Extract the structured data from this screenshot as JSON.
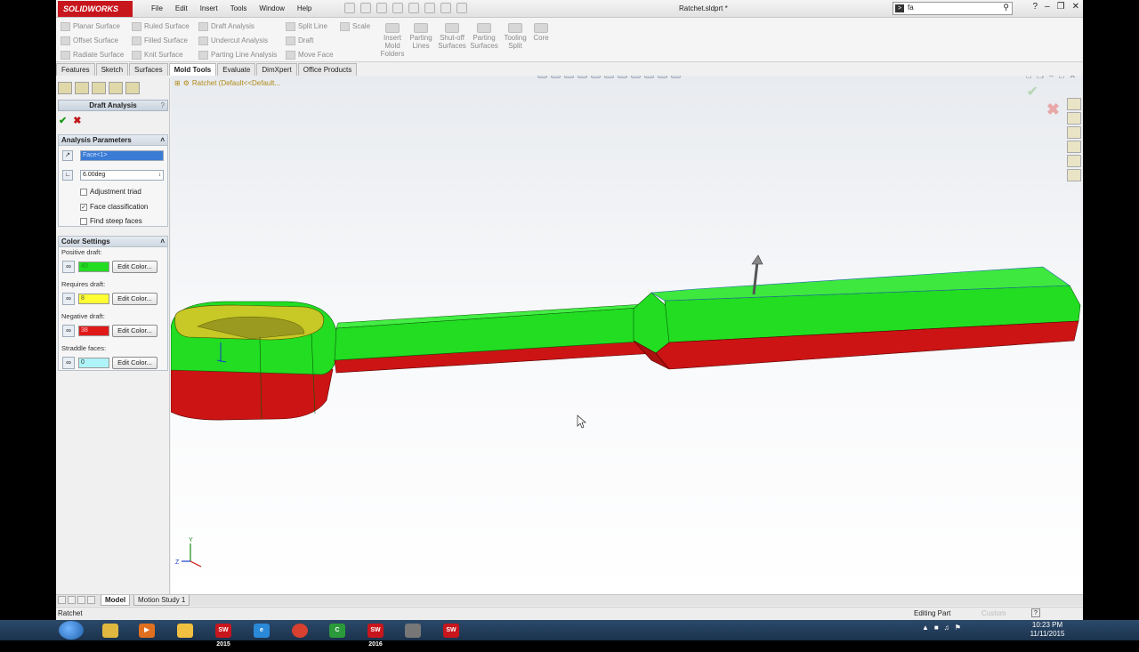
{
  "app": {
    "brand": "SOLIDWORKS",
    "document_title": "Ratchet.sldprt *"
  },
  "menu": [
    "File",
    "Edit",
    "Insert",
    "Tools",
    "Window",
    "Help"
  ],
  "search": {
    "value": "fa"
  },
  "command_manager": {
    "col1": [
      "Planar Surface",
      "Offset Surface",
      "Radiate Surface"
    ],
    "col2": [
      "Ruled Surface",
      "Filled Surface",
      "Knit Surface"
    ],
    "col3": [
      "Draft Analysis",
      "Undercut Analysis",
      "Parting Line Analysis"
    ],
    "col4": [
      "Split Line",
      "Draft",
      "Move Face"
    ],
    "scale": "Scale",
    "big": [
      {
        "label": "Insert Mold Folders"
      },
      {
        "label": "Parting Lines"
      },
      {
        "label": "Shut-off Surfaces"
      },
      {
        "label": "Parting Surfaces"
      },
      {
        "label": "Tooling Split"
      },
      {
        "label": "Core"
      }
    ]
  },
  "tabs": [
    "Features",
    "Sketch",
    "Surfaces",
    "Mold Tools",
    "Evaluate",
    "DimXpert",
    "Office Products"
  ],
  "active_tab": "Mold Tools",
  "property_manager": {
    "title": "Draft Analysis",
    "help": "?",
    "analysis_parameters": {
      "header": "Analysis Parameters",
      "direction_face": "Face<1>",
      "draft_angle": "6.00deg",
      "options": [
        {
          "label": "Adjustment triad",
          "checked": false
        },
        {
          "label": "Face classification",
          "checked": true
        },
        {
          "label": "Find steep faces",
          "checked": false
        }
      ]
    },
    "color_settings": {
      "header": "Color Settings",
      "items": [
        {
          "label": "Positive draft:",
          "count": "40",
          "color": "#22dd22"
        },
        {
          "label": "Requires draft:",
          "count": "8",
          "color": "#ffff33"
        },
        {
          "label": "Negative draft:",
          "count": "38",
          "color": "#e01818"
        },
        {
          "label": "Straddle faces:",
          "count": "0",
          "color": "#aef4f8"
        }
      ],
      "button_label": "Edit Color..."
    }
  },
  "viewport": {
    "tree_flyout": "Ratchet  (Default<<Default..."
  },
  "bottom_tabs": [
    "Model",
    "Motion Study 1"
  ],
  "status": {
    "left": "Ratchet",
    "mode": "Editing Part",
    "units": "Custom"
  },
  "taskbar": {
    "apps": [
      "SW 2015",
      "SW 2016",
      "SW"
    ],
    "time": "10:23 PM",
    "date": "11/11/2015"
  },
  "colors": {
    "positive": "#22dd22",
    "negative": "#cc1414",
    "requires": "#ffff33"
  }
}
